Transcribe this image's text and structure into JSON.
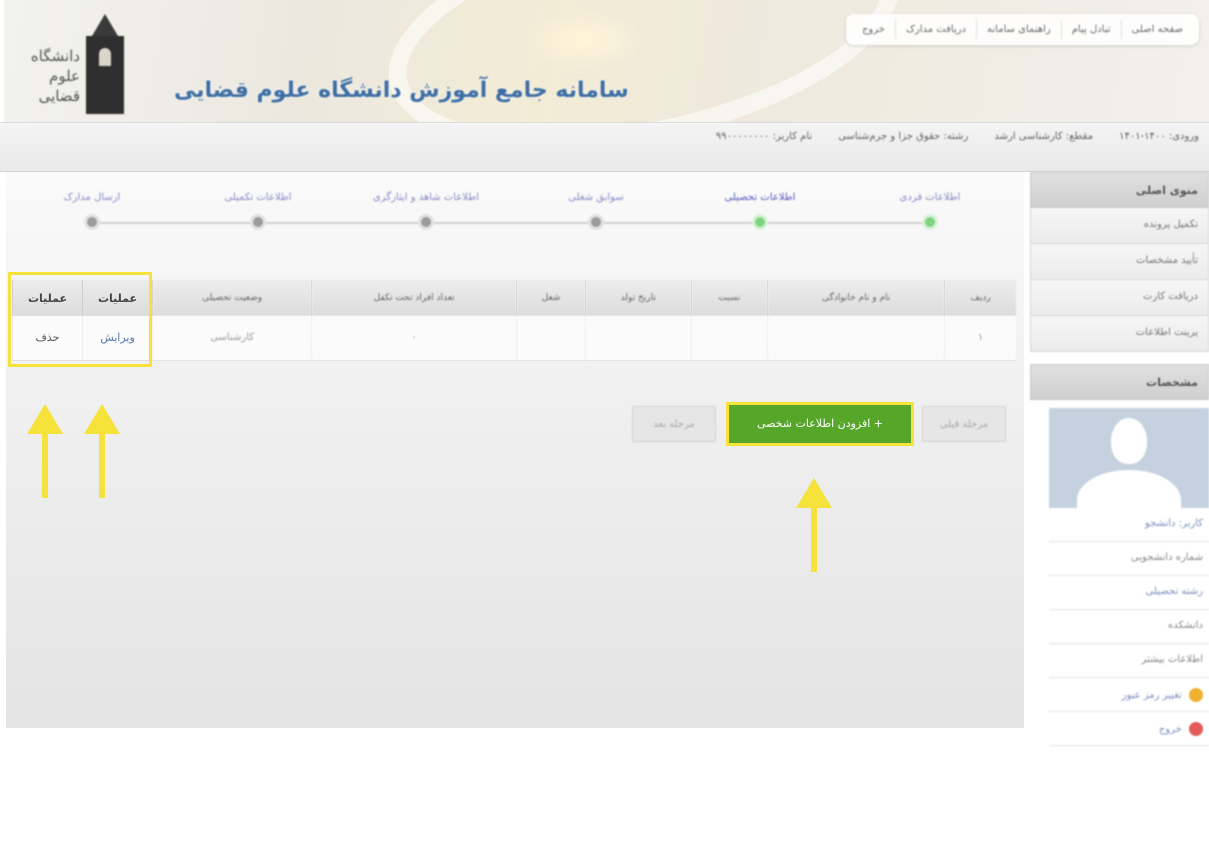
{
  "header": {
    "site_title": "سامانه جامع آموزش دانشگاه علوم قضایی",
    "logo_text": "دانشگاه\nعلوم قضایی",
    "nav": [
      "صفحه اصلی",
      "تبادل پیام",
      "راهنمای سامانه",
      "دریافت مدارک",
      "خروج"
    ]
  },
  "infobar": {
    "items": [
      "نام کاربر: ۹۹۰۰۰۰۰۰۰۰",
      "رشته: حقوق جزا و جرم‌شناسی",
      "مقطع: کارشناسی ارشد",
      "ورودی: ۱۴۰۰-۱۴۰۱"
    ]
  },
  "sidebar": {
    "menu_title": "منوی اصلی",
    "menu_items": [
      "تکمیل پرونده",
      "تأیید مشخصات",
      "دریافت کارت",
      "پرینت اطلاعات"
    ],
    "profile_title": "مشخصات",
    "profile_lines": [
      "کاربر: دانشجو",
      "شماره دانشجویی",
      "رشته تحصیلی",
      "دانشکده",
      "اطلاعات بیشتر",
      "تغییر رمز عبور",
      "خروج"
    ],
    "profile_dot_colors": [
      "#f0b030",
      "#e25a5a"
    ]
  },
  "stepper": {
    "steps": [
      "اطلاعات فردی",
      "اطلاعات تحصیلی",
      "سوابق شغلی",
      "اطلاعات شاهد و ایثارگری",
      "اطلاعات تکمیلی",
      "ارسال مدارک"
    ]
  },
  "table": {
    "headers": [
      "ردیف",
      "نام و نام خانوادگی",
      "نسبت",
      "تاریخ تولد",
      "شغل",
      "تعداد افراد تحت تکفل",
      "وضعیت تحصیلی"
    ],
    "ops_header_1": "عملیات",
    "ops_header_2": "عملیات",
    "row": [
      "۱",
      "",
      "",
      "",
      "",
      "۰",
      "کارشناسی"
    ],
    "edit_label": "ویرایش",
    "delete_label": "حذف"
  },
  "actions": {
    "prev_label": "مرحله قبلی",
    "add_label": "+ افزودن اطلاعات شخصی",
    "next_label": "مرحله بعد"
  },
  "colors": {
    "highlight": "#f5e23a",
    "add_button": "#56a62a",
    "step_done": "#7fd47f"
  }
}
